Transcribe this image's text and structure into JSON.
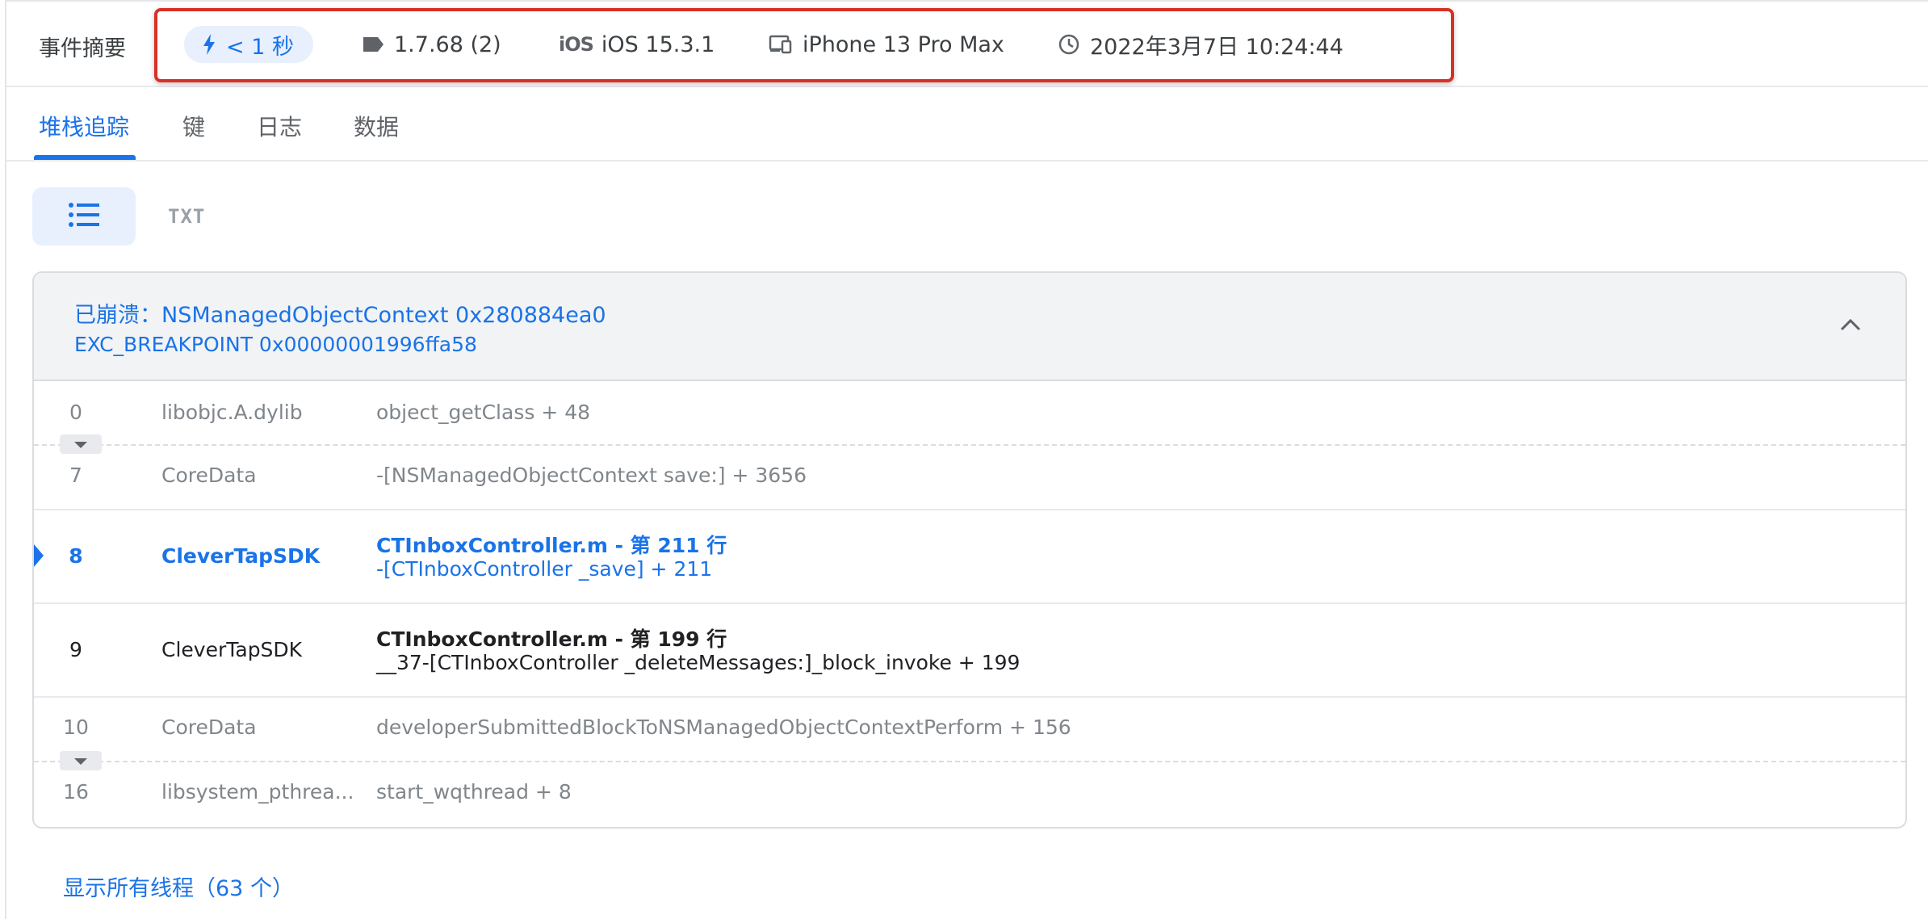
{
  "summary": {
    "title": "事件摘要",
    "duration": "< 1 秒",
    "version": "1.7.68 (2)",
    "os_logo": "iOS",
    "os": "iOS 15.3.1",
    "device": "iPhone 13 Pro Max",
    "time": "2022年3月7日 10:24:44",
    "highlight_color": "#d93025"
  },
  "tabs": [
    {
      "label": "堆栈追踪",
      "active": true
    },
    {
      "label": "键",
      "active": false
    },
    {
      "label": "日志",
      "active": false
    },
    {
      "label": "数据",
      "active": false
    }
  ],
  "view_toggle": {
    "list_icon": "list-icon",
    "txt_label": "TXT"
  },
  "crash": {
    "title": "已崩溃：NSManagedObjectContext 0x280884ea0",
    "subtitle": "EXC_BREAKPOINT 0x00000001996ffa58"
  },
  "frames": [
    {
      "num": "0",
      "lib": "libobjc.A.dylib",
      "symbol": "object_getClass + 48"
    },
    {
      "num": "7",
      "lib": "CoreData",
      "symbol": "-[NSManagedObjectContext save:] + 3656"
    },
    {
      "num": "8",
      "lib": "CleverTapSDK",
      "file": "CTInboxController.m - 第 211 行",
      "symbol": "-[CTInboxController _save] + 211"
    },
    {
      "num": "9",
      "lib": "CleverTapSDK",
      "file": "CTInboxController.m - 第 199 行",
      "symbol": "__37-[CTInboxController _deleteMessages:]_block_invoke + 199"
    },
    {
      "num": "10",
      "lib": "CoreData",
      "symbol": "developerSubmittedBlockToNSManagedObjectContextPerform + 156"
    },
    {
      "num": "16",
      "lib": "libsystem_pthrea...",
      "symbol": "start_wqthread + 8"
    }
  ],
  "show_all_threads": "显示所有线程（63 个）",
  "colors": {
    "accent": "#1a73e8",
    "muted": "#80868b",
    "panel_header": "#f1f3f4"
  }
}
